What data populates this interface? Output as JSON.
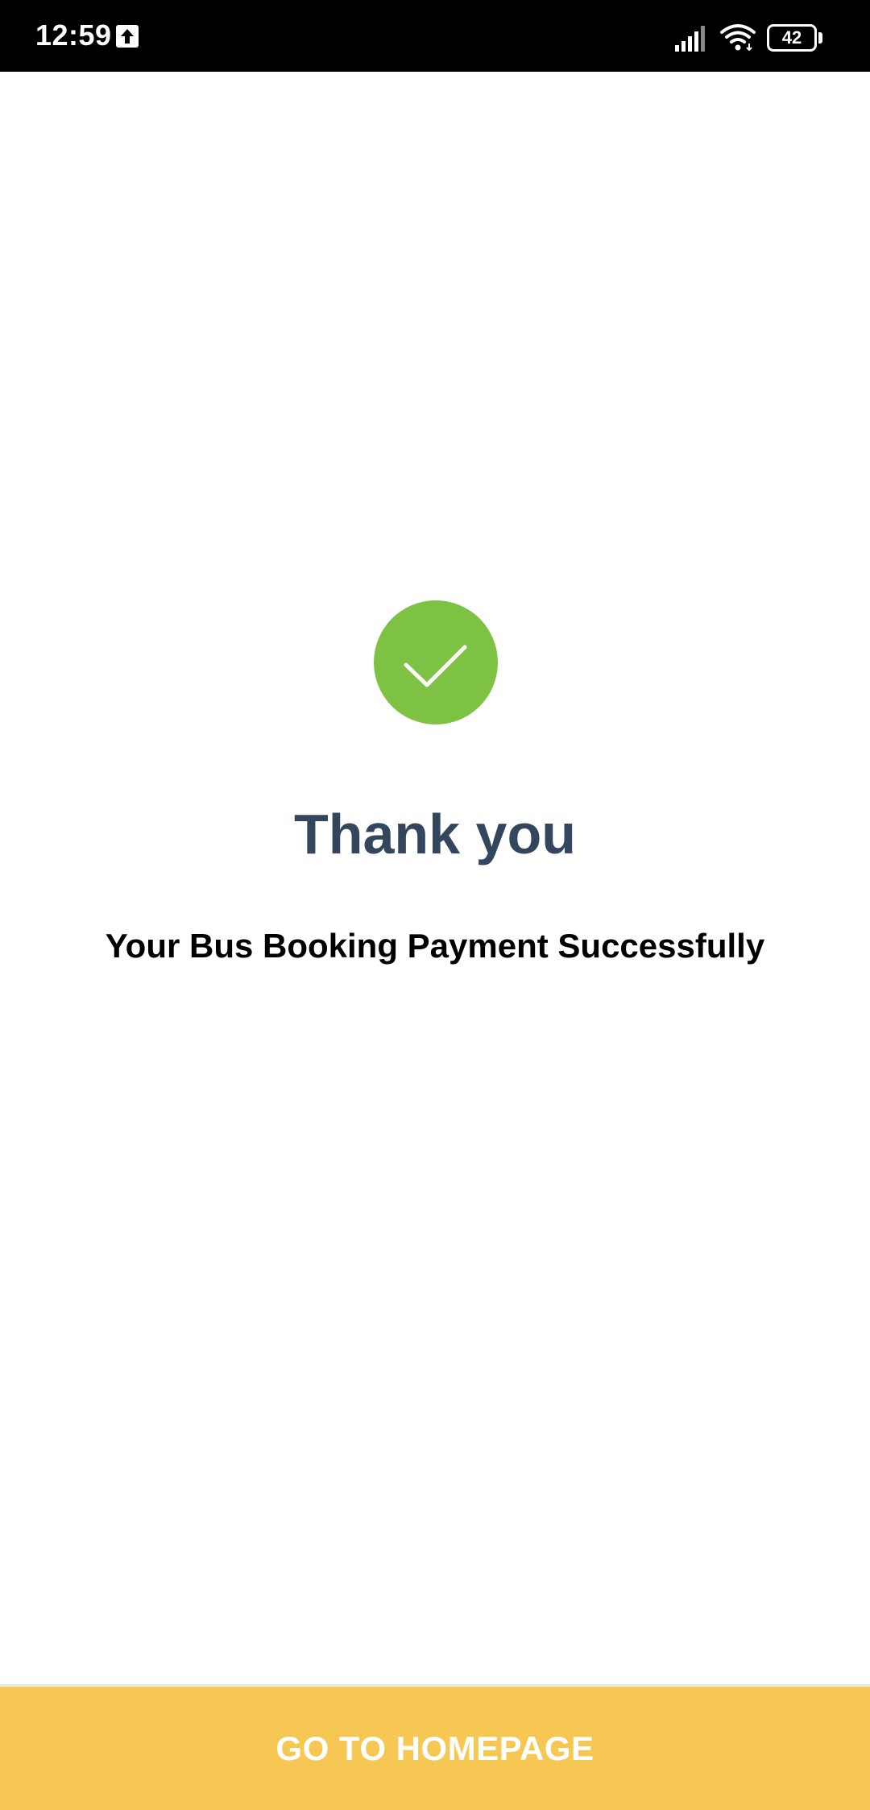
{
  "status_bar": {
    "time": "12:59",
    "battery_level": "42",
    "icons": [
      "upload-icon",
      "signal-icon",
      "wifi-icon",
      "battery-icon"
    ]
  },
  "confirmation": {
    "icon": "check-circle-icon",
    "icon_color": "#7dc242",
    "title": "Thank you",
    "title_color": "#34465e",
    "message": "Your Bus Booking Payment Successfully"
  },
  "footer": {
    "button_label": "GO TO HOMEPAGE",
    "button_color": "#f6c752"
  }
}
